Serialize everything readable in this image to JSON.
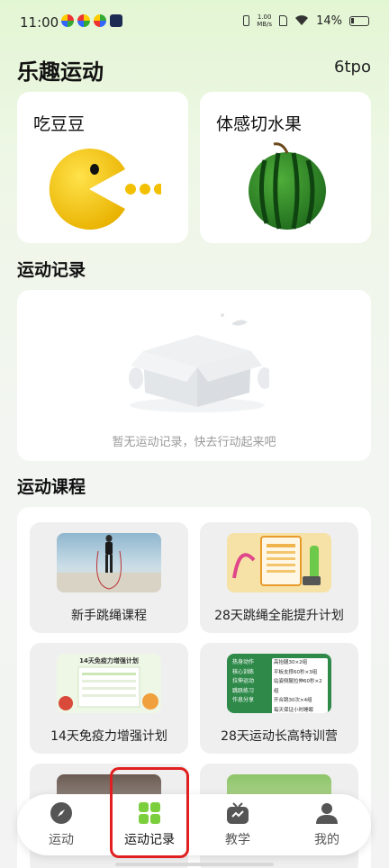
{
  "status_bar": {
    "time": "11:00",
    "net_speed": "1.00",
    "net_unit": "MB/s",
    "battery": "14%"
  },
  "header": {
    "title": "乐趣运动",
    "user_code": "6tpo"
  },
  "games": [
    {
      "label": "吃豆豆",
      "icon": "pacman-icon"
    },
    {
      "label": "体感切水果",
      "icon": "watermelon-icon"
    }
  ],
  "records": {
    "title": "运动记录",
    "empty_text": "暂无运动记录，快去行动起来吧"
  },
  "courses": {
    "title": "运动课程",
    "items": [
      {
        "label": "新手跳绳课程"
      },
      {
        "label": "28天跳绳全能提升计划"
      },
      {
        "label": "14天免疫力增强计划",
        "thumb_text": "14天免疫力增强计划"
      },
      {
        "label": "28天运动长高特训营",
        "thumb_lines": [
          "热身动作",
          "核心训练",
          "拉伸运动",
          "跳跃练习",
          "作息分享",
          "高抬腿30×2组",
          "平板支撑60秒×3组",
          "站姿侧腿拉伸60秒×2组",
          "开合跳30次×4组",
          "每天保证小时睡眠"
        ]
      },
      {
        "label": ""
      },
      {
        "label": ""
      }
    ]
  },
  "bottom_nav": [
    {
      "label": "运动",
      "icon": "compass-icon"
    },
    {
      "label": "运动记录",
      "icon": "grid-icon",
      "active": true
    },
    {
      "label": "教学",
      "icon": "tv-icon"
    },
    {
      "label": "我的",
      "icon": "person-icon"
    }
  ],
  "colors": {
    "accent": "#7ccf3c",
    "highlight": "#e02020",
    "pacman": "#f5c400"
  }
}
